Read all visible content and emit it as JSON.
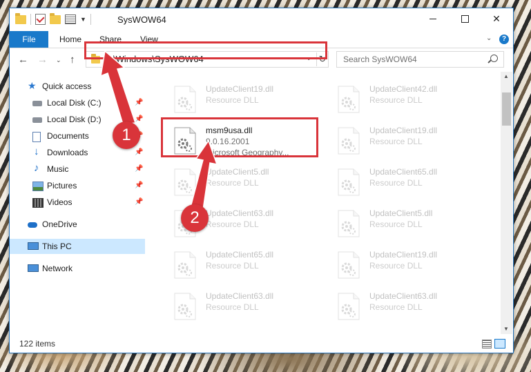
{
  "window": {
    "title": "SysWOW64",
    "controls": {
      "minimize": "minimize",
      "maximize": "maximize",
      "close": "✕"
    }
  },
  "ribbon": {
    "tabs": [
      "File",
      "Home",
      "Share",
      "View"
    ],
    "expand_glyph": "⌄",
    "help_glyph": "?"
  },
  "navigation": {
    "back_glyph": "←",
    "forward_glyph": "→",
    "recent_glyph": "⌄",
    "up_glyph": "↑"
  },
  "address_bar": {
    "path": "C:\\Windows\\SysWOW64",
    "dropdown_glyph": "⌄",
    "refresh_glyph": "↻"
  },
  "search": {
    "placeholder": "Search SysWOW64"
  },
  "sidebar": {
    "items": [
      {
        "label": "Quick access",
        "icon": "star-icon",
        "pinned": false
      },
      {
        "label": "Local Disk (C:)",
        "icon": "drive-icon",
        "pinned": true
      },
      {
        "label": "Local Disk (D:)",
        "icon": "drive-icon",
        "pinned": true
      },
      {
        "label": "Documents",
        "icon": "documents-icon",
        "pinned": true
      },
      {
        "label": "Downloads",
        "icon": "download-icon",
        "pinned": true
      },
      {
        "label": "Music",
        "icon": "music-icon",
        "pinned": true
      },
      {
        "label": "Pictures",
        "icon": "pictures-icon",
        "pinned": true
      },
      {
        "label": "Videos",
        "icon": "video-icon",
        "pinned": true
      },
      {
        "label": "OneDrive",
        "icon": "cloud-icon",
        "pinned": false
      },
      {
        "label": "This PC",
        "icon": "computer-icon",
        "pinned": false,
        "selected": true
      },
      {
        "label": "Network",
        "icon": "network-icon",
        "pinned": false
      }
    ],
    "pin_glyph": "📌"
  },
  "files": [
    {
      "name": "UpdateClient19.dll",
      "line2": "Resource DLL",
      "line3": "",
      "faded": true
    },
    {
      "name": "UpdateClient42.dll",
      "line2": "Resource DLL",
      "line3": "",
      "faded": true
    },
    {
      "name": "msm9usa.dll",
      "line2": "9.0.16.2001",
      "line3": "Microsoft Geography...",
      "faded": false
    },
    {
      "name": "UpdateClient19.dll",
      "line2": "Resource DLL",
      "line3": "",
      "faded": true
    },
    {
      "name": "UpdateClient5.dll",
      "line2": "Resource DLL",
      "line3": "",
      "faded": true
    },
    {
      "name": "UpdateClient65.dll",
      "line2": "Resource DLL",
      "line3": "",
      "faded": true
    },
    {
      "name": "UpdateClient63.dll",
      "line2": "Resource DLL",
      "line3": "",
      "faded": true
    },
    {
      "name": "UpdateClient5.dll",
      "line2": "Resource DLL",
      "line3": "",
      "faded": true
    },
    {
      "name": "UpdateClient65.dll",
      "line2": "Resource DLL",
      "line3": "",
      "faded": true
    },
    {
      "name": "UpdateClient19.dll",
      "line2": "Resource DLL",
      "line3": "",
      "faded": true
    },
    {
      "name": "UpdateClient63.dll",
      "line2": "Resource DLL",
      "line3": "",
      "faded": true
    },
    {
      "name": "UpdateClient63.dll",
      "line2": "Resource DLL",
      "line3": "",
      "faded": true
    }
  ],
  "status_bar": {
    "item_count": "122 items"
  },
  "callouts": [
    {
      "label": "1"
    },
    {
      "label": "2"
    }
  ],
  "colors": {
    "accent": "#1979ca",
    "callout": "#d9343a",
    "selection": "#cce8ff"
  }
}
